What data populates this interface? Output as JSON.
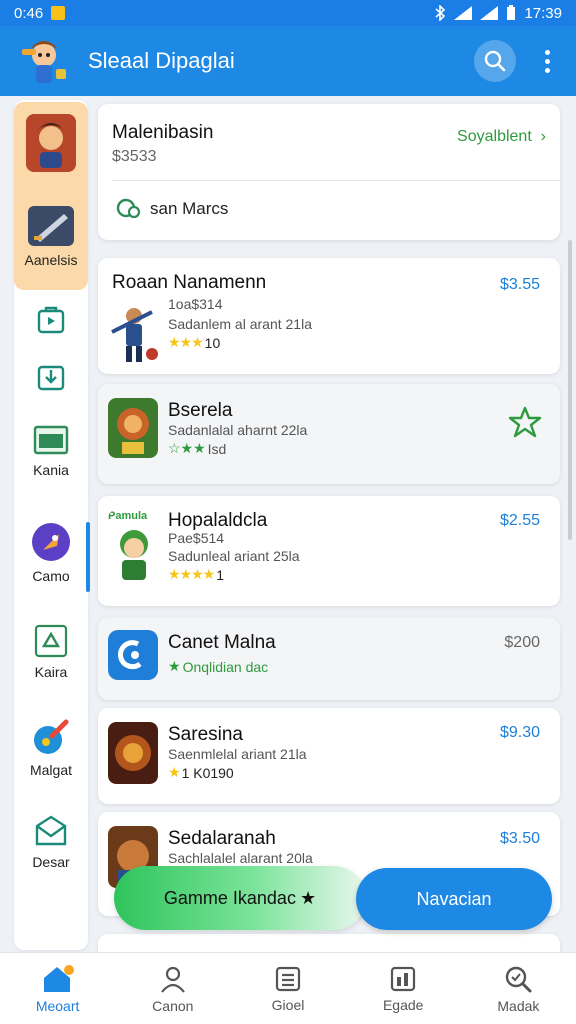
{
  "status": {
    "time": "0:46",
    "clock": "17:39"
  },
  "appbar": {
    "title": "Sleaal Dipaglai",
    "search_icon": "search-icon",
    "more_icon": "more-vert-icon"
  },
  "rail": {
    "items": [
      {
        "label": "Aanelsis",
        "icon": "game-art-icon",
        "active": true
      },
      {
        "label": "",
        "icon": "bag-icon"
      },
      {
        "label": "",
        "icon": "download-icon"
      },
      {
        "label": "Kania",
        "icon": "window-icon"
      },
      {
        "label": "Camo",
        "icon": "rocket-icon"
      },
      {
        "label": "Kaira",
        "icon": "recycle-icon"
      },
      {
        "label": "Malgat",
        "icon": "brush-icon"
      },
      {
        "label": "Desar",
        "icon": "envelope-icon"
      }
    ]
  },
  "featured": {
    "title": "Malenibasin",
    "subtitle": "$3533",
    "link": "Soyalblent",
    "filter_label": "san Marcs"
  },
  "games": [
    {
      "title": "Roaan Nanamenn",
      "line1": "1oa$314",
      "line2": "Sadanlem al arant 21la",
      "rating": "10",
      "price": "$3.55"
    },
    {
      "title": "Bserela",
      "line1": "Sadanlalal aharnt 22la",
      "rating": "Isd"
    },
    {
      "title": "Hopalaldcla",
      "badge": "Pamula",
      "line1": "Pae$514",
      "line2": "Sadunleal ariant 25la",
      "rating": "1",
      "price": "$2.55"
    },
    {
      "title": "Canet Malna",
      "line1": "Onqlidian dac",
      "price": "$200"
    },
    {
      "title": "Saresina",
      "line1": "Saenmlelal ariant 21la",
      "rating": "1 K0190",
      "price": "$9.30"
    },
    {
      "title": "Sedalaranah",
      "line1": "Sachlalalel alarant 20la",
      "price": "$3.50"
    }
  ],
  "actions": {
    "left": "Gamme Ikandac",
    "right": "Navacian"
  },
  "bottom_nav": [
    {
      "label": "Meoart",
      "icon": "home-icon",
      "active": true
    },
    {
      "label": "Canon",
      "icon": "person-group-icon"
    },
    {
      "label": "Gioel",
      "icon": "list-icon"
    },
    {
      "label": "Egade",
      "icon": "chart-icon"
    },
    {
      "label": "Madak",
      "icon": "magnifier-icon"
    }
  ],
  "colors": {
    "primary": "#1e88e5",
    "accent_green": "#2e9b3e",
    "rating": "#f5c518",
    "rail_active": "#fbd9a8"
  }
}
